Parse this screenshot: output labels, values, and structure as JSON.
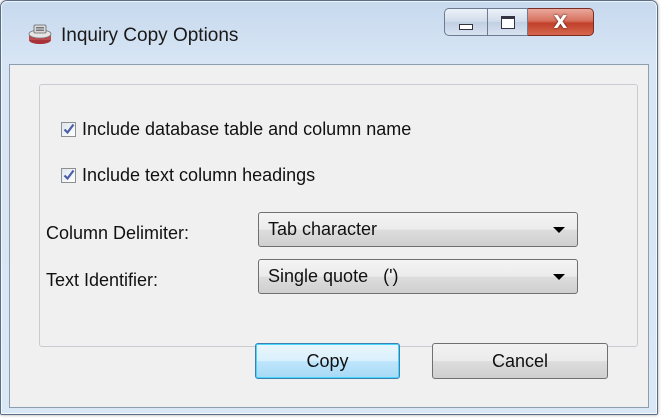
{
  "window": {
    "title": "Inquiry Copy Options",
    "app_icon": "app-icon"
  },
  "title_controls": {
    "minimize_icon": "minimize-icon",
    "maximize_icon": "maximize-icon",
    "close_glyph": "X"
  },
  "options": {
    "include_table_column_name": {
      "label": "Include database table and column name",
      "checked": true
    },
    "include_text_headings": {
      "label": "Include text column headings",
      "checked": true
    }
  },
  "fields": {
    "column_delimiter": {
      "label": "Column Delimiter:",
      "value": "Tab character"
    },
    "text_identifier": {
      "label": "Text Identifier:",
      "value": "Single quote   (')"
    }
  },
  "buttons": {
    "copy": "Copy",
    "cancel": "Cancel"
  },
  "colors": {
    "accent": "#3c7fb1",
    "close_button": "#c2412b",
    "check": "#4a5fa8"
  }
}
